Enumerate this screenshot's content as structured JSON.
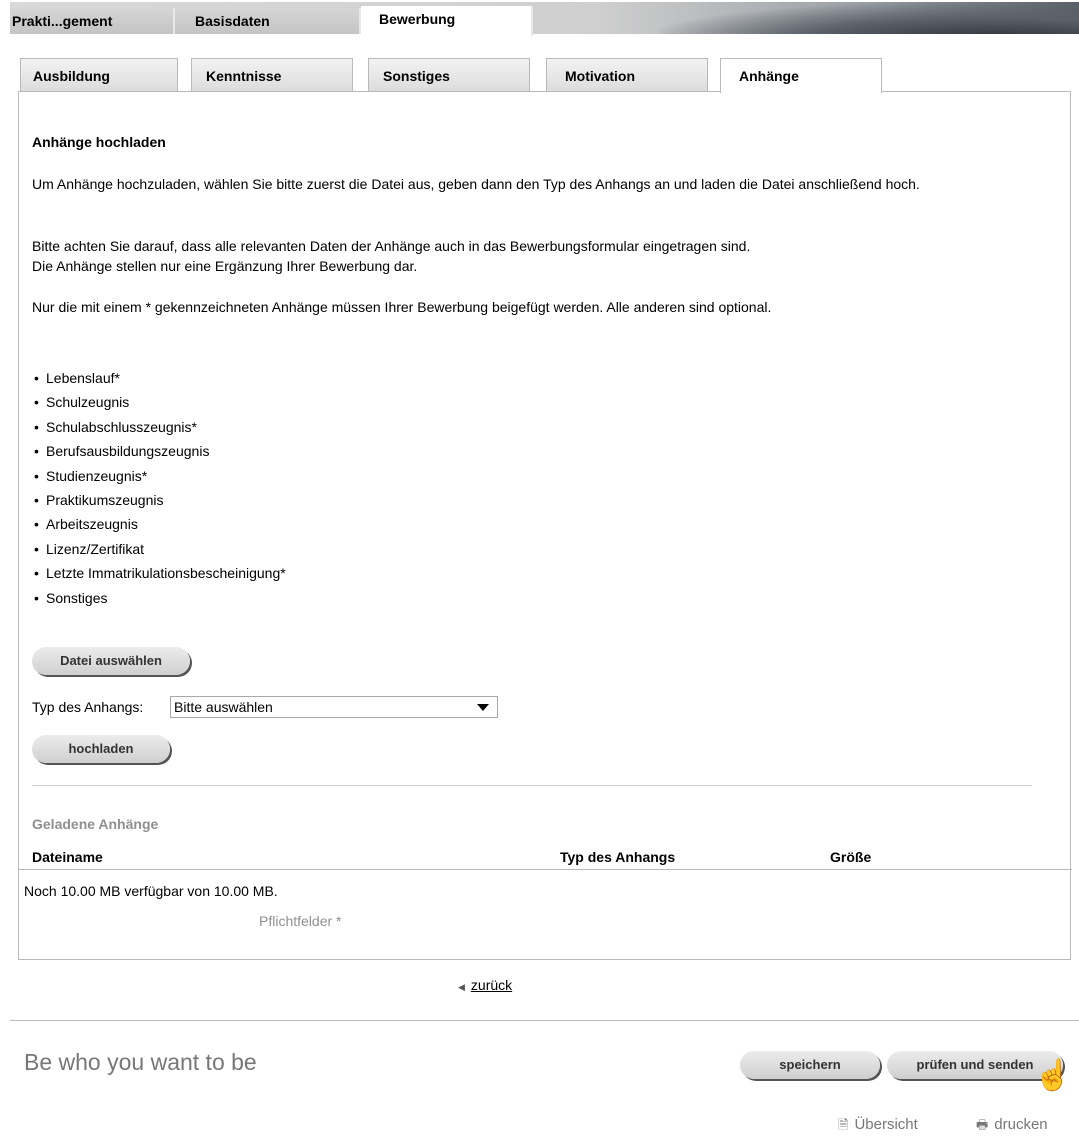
{
  "top_tabs": [
    {
      "label": "Prakti...gement"
    },
    {
      "label": "Basisdaten"
    },
    {
      "label": "Bewerbung"
    }
  ],
  "sub_tabs": [
    {
      "label": "Ausbildung"
    },
    {
      "label": "Kenntnisse"
    },
    {
      "label": "Sonstiges"
    },
    {
      "label": "Motivation"
    },
    {
      "label": "Anhänge"
    }
  ],
  "upload": {
    "title": "Anhänge hochladen",
    "para1": "Um Anhänge hochzuladen, wählen Sie bitte zuerst die Datei aus, geben dann den Typ des Anhangs an und laden die Datei anschließend hoch.",
    "para2_line1": "Bitte achten Sie darauf, dass alle relevanten Daten der Anhänge auch in das Bewerbungsformular eingetragen sind.",
    "para2_line2": "Die Anhänge stellen nur eine Ergänzung Ihrer Bewerbung dar.",
    "para3": "Nur die mit einem * gekennzeichneten Anhänge müssen Ihrer Bewerbung beigefügt werden. Alle anderen sind optional.",
    "items": [
      "Lebenslauf*",
      "Schulzeugnis",
      "Schulabschlusszeugnis*",
      "Berufsausbildungszeugnis",
      "Studienzeugnis*",
      "Praktikumszeugnis",
      "Arbeitszeugnis",
      "Lizenz/Zertifikat",
      "Letzte Immatrikulationsbescheinigung*",
      "Sonstiges"
    ],
    "choose_file_label": "Datei auswählen",
    "type_label": "Typ des Anhangs:",
    "type_value": "Bitte auswählen",
    "upload_label": "hochladen"
  },
  "loaded": {
    "title": "Geladene Anhänge",
    "col_filename": "Dateiname",
    "col_type": "Typ des Anhangs",
    "col_size": "Größe",
    "available": "Noch 10.00 MB verfügbar von 10.00 MB.",
    "required_note": "Pflichtfelder *"
  },
  "nav": {
    "back_label": "zurück"
  },
  "footer": {
    "slogan": "Be who you want to be",
    "save_label": "speichern",
    "check_send_label": "prüfen und senden",
    "overview_label": "Übersicht",
    "print_label": "drucken"
  }
}
